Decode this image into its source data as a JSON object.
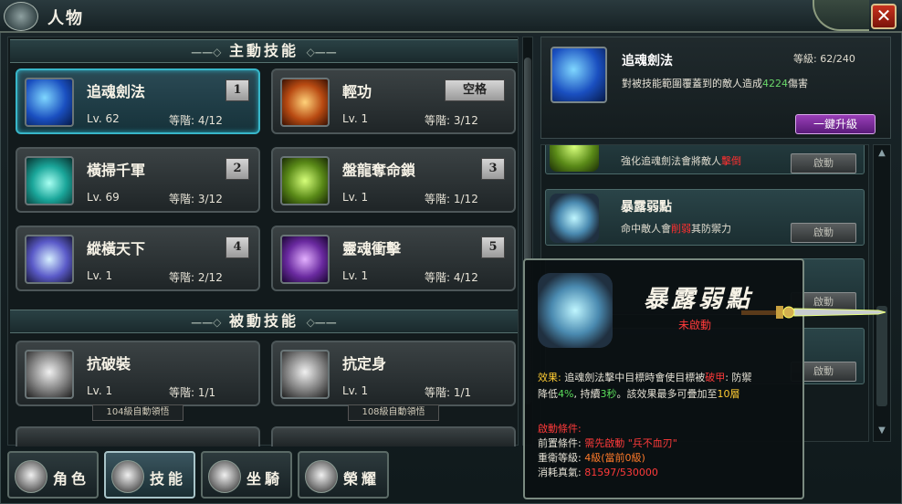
{
  "window": {
    "title": "人物",
    "close_label": "✕"
  },
  "active_section": {
    "title": "主動技能",
    "left_ornament": "——◇",
    "right_ornament": "◇——"
  },
  "passive_section": {
    "title": "被動技能",
    "left_ornament": "——◇",
    "right_ornament": "◇——"
  },
  "level_prefix": "Lv.",
  "tier_prefix": "等階:",
  "active_skills": [
    {
      "name": "追魂劍法",
      "level": "62",
      "tier": "4/12",
      "key": "1",
      "icon": "blue-sword-slash-icon",
      "selected": true
    },
    {
      "name": "輕功",
      "level": "1",
      "tier": "3/12",
      "key": "空格",
      "icon": "flame-leap-icon"
    },
    {
      "name": "橫掃千軍",
      "level": "69",
      "tier": "3/12",
      "key": "2",
      "icon": "cyan-whirl-icon"
    },
    {
      "name": "盤龍奪命鎖",
      "level": "1",
      "tier": "1/12",
      "key": "3",
      "icon": "green-chain-icon"
    },
    {
      "name": "縱橫天下",
      "level": "1",
      "tier": "2/12",
      "key": "4",
      "icon": "violet-spin-icon"
    },
    {
      "name": "靈魂衝擊",
      "level": "1",
      "tier": "4/12",
      "key": "5",
      "icon": "purple-soul-icon"
    }
  ],
  "passive_skills": [
    {
      "name": "抗破裝",
      "level": "1",
      "tier": "1/1",
      "auto_note": "104級自動領悟",
      "icon": "armor-figure-icon"
    },
    {
      "name": "抗定身",
      "level": "1",
      "tier": "1/1",
      "auto_note": "108級自動領悟",
      "icon": "flex-figure-icon"
    }
  ],
  "tabs": [
    {
      "label": "角色",
      "icon": "character-icon"
    },
    {
      "label": "技能",
      "icon": "skill-icon",
      "active": true
    },
    {
      "label": "坐騎",
      "icon": "horse-icon"
    },
    {
      "label": "榮耀",
      "icon": "honor-icon"
    }
  ],
  "detail": {
    "name": "追魂劍法",
    "level_label": "等級: 62/240",
    "desc_before": "對被技能範圍覆蓋到的敵人造成",
    "desc_value": "4224",
    "desc_after": "傷害",
    "upgrade_label": "一鍵升級"
  },
  "passive_list": [
    {
      "desc_before": "強化追魂劍法會將敵人",
      "desc_red": "擊倒",
      "desc_after": "",
      "button": "啟動"
    },
    {
      "name": "暴露弱點",
      "desc_before": "命中敵人會",
      "desc_red": "削弱",
      "desc_after": "其防禦力",
      "button": "啟動"
    },
    {
      "button": "啟動"
    },
    {
      "button": "啟動"
    }
  ],
  "tooltip": {
    "title": "暴露弱點",
    "status": "未啟動",
    "effect_label": "效果:",
    "effect_text_1": "追魂劍法擊中目標時會使目標被",
    "effect_red": "破甲",
    "effect_text_2": ": 防禦",
    "effect_text_3": "降低",
    "effect_pct": "4%",
    "effect_text_4": ", 持續",
    "effect_dur": "3秒",
    "effect_text_5": "。該效果最多可疊加至",
    "effect_stack": "10層",
    "cond_label": "啟動條件:",
    "pre_label": "前置條件:",
    "pre_value": "需先啟動 \"兵不血刃\"",
    "rank_label": "重衛等級:",
    "rank_value": "4級(當前0級)",
    "cost_label": "消耗真氣:",
    "cost_value": "81597/530000"
  }
}
